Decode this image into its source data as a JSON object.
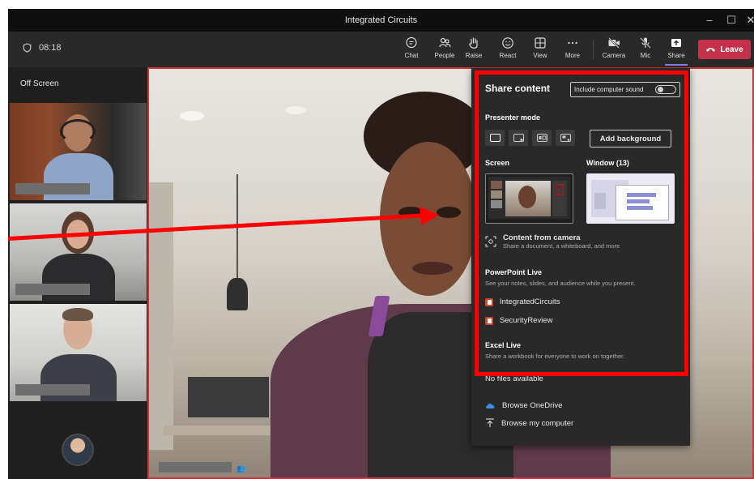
{
  "window": {
    "title": "Integrated Circuits",
    "controls": [
      "–",
      "☐",
      "✕"
    ]
  },
  "toolbar": {
    "timer": "08:18",
    "buttons": [
      {
        "label": "Chat",
        "icon": "chat-icon"
      },
      {
        "label": "People",
        "icon": "people-icon"
      },
      {
        "label": "Raise",
        "icon": "raise-hand-icon"
      },
      {
        "label": "React",
        "icon": "react-smiley-icon"
      },
      {
        "label": "View",
        "icon": "view-grid-icon"
      },
      {
        "label": "More",
        "icon": "more-icon"
      },
      {
        "label": "Camera",
        "icon": "camera-off-icon"
      },
      {
        "label": "Mic",
        "icon": "mic-off-icon"
      },
      {
        "label": "Share",
        "icon": "share-tray-icon",
        "active": true
      }
    ],
    "leave_label": "Leave"
  },
  "left_panel": {
    "offscreen_label": "Off Screen"
  },
  "share_panel": {
    "title": "Share content",
    "include_sound_label": "Include computer sound",
    "include_sound_on": false,
    "presenter_mode_label": "Presenter mode",
    "add_background_label": "Add background",
    "screen_label": "Screen",
    "window_label": "Window (13)",
    "camera_title": "Content from camera",
    "camera_sub": "Share a document, a whiteboard, and more",
    "ppt_title": "PowerPoint Live",
    "ppt_sub": "See your notes, slides, and audience while you present.",
    "ppt_files": [
      "IntegratedCircuits",
      "SecurityReview"
    ],
    "excel_title": "Excel Live",
    "excel_sub": "Share a workbook for everyone to work on together.",
    "no_files": "No files available",
    "browse_onedrive": "Browse OneDrive",
    "browse_computer": "Browse my computer"
  },
  "colors": {
    "accent": "#7f85f5",
    "leave": "#c4314b",
    "highlight": "#ff0000"
  }
}
